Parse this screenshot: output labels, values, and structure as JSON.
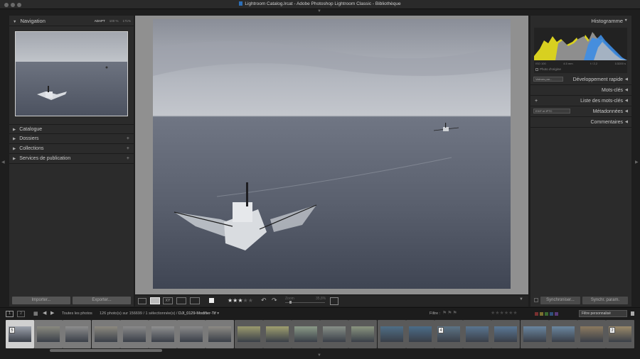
{
  "window": {
    "title": "Lightroom Catalog.lrcat - Adobe Photoshop Lightroom Classic - Bibliothèque"
  },
  "left_panel": {
    "navigation": {
      "label": "Navigation",
      "options": [
        "ADAPT",
        "100 %",
        "171%"
      ]
    },
    "sections": [
      {
        "label": "Catalogue"
      },
      {
        "label": "Dossiers"
      },
      {
        "label": "Collections"
      },
      {
        "label": "Services de publication"
      }
    ],
    "import_label": "Importer...",
    "export_label": "Exporter..."
  },
  "right_panel": {
    "histogram_label": "Histogramme",
    "exif": {
      "iso": "ISO 100",
      "focal": "4.5 mm",
      "aperture": "f / 2,2",
      "shutter": "1/3200 s"
    },
    "original_photo_label": "Photo d'origine",
    "sections": [
      {
        "label": "Développement rapide",
        "select": "Valeurs par..."
      },
      {
        "label": "Mots-clés"
      },
      {
        "label": "Liste des mots-clés"
      },
      {
        "label": "Métadonnées",
        "select": "EXIF et IPTC"
      },
      {
        "label": "Commentaires"
      }
    ],
    "sync_label": "Synchroniser...",
    "sync_settings_label": "Synchr. param."
  },
  "toolbar": {
    "rating_stars": 3,
    "zoom_label": "Zoom",
    "zoom_value": "35,8%"
  },
  "filmstrip_bar": {
    "pages": [
      "1",
      "2"
    ],
    "source_label": "Toutes les photos",
    "count_text": "126 photo(s) sur 156699 / 1 sélectionnée(s) /",
    "filename": "DJI_0129-Modifier-Tif",
    "filter_label": "Filtre :",
    "filter_value": "Filtre personnalisé"
  },
  "filmstrip": {
    "items": [
      {
        "badge": "5",
        "selected": true,
        "tone": "#9ea3ad"
      },
      {
        "badge": "",
        "tone": "#8a8a80"
      },
      {
        "badge": "",
        "tone": "#8e8e8e"
      },
      {
        "badge": "",
        "tone": "#8d8a80"
      },
      {
        "badge": "",
        "tone": "#8a8a8a"
      },
      {
        "badge": "",
        "tone": "#909090"
      },
      {
        "badge": "",
        "tone": "#8a8a8a"
      },
      {
        "badge": "",
        "tone": "#8d8b85"
      },
      {
        "badge": "",
        "tone": "#9b9a6e"
      },
      {
        "badge": "",
        "tone": "#a0a070"
      },
      {
        "badge": "",
        "tone": "#8b9b88"
      },
      {
        "badge": "",
        "tone": "#889088"
      },
      {
        "badge": "",
        "tone": "#8b9680"
      },
      {
        "badge": "",
        "tone": "#4f6e86"
      },
      {
        "badge": "",
        "tone": "#4b6c88"
      },
      {
        "badge": "4",
        "tone": "#5d7486"
      },
      {
        "badge": "",
        "tone": "#5a7590"
      },
      {
        "badge": "",
        "tone": "#5b7896"
      },
      {
        "badge": "",
        "tone": "#6a86a0"
      },
      {
        "badge": "",
        "tone": "#6b87a0"
      },
      {
        "badge": "",
        "tone": "#8c7a60"
      },
      {
        "badge": "2",
        "tone": "#9c8a6a"
      }
    ]
  }
}
